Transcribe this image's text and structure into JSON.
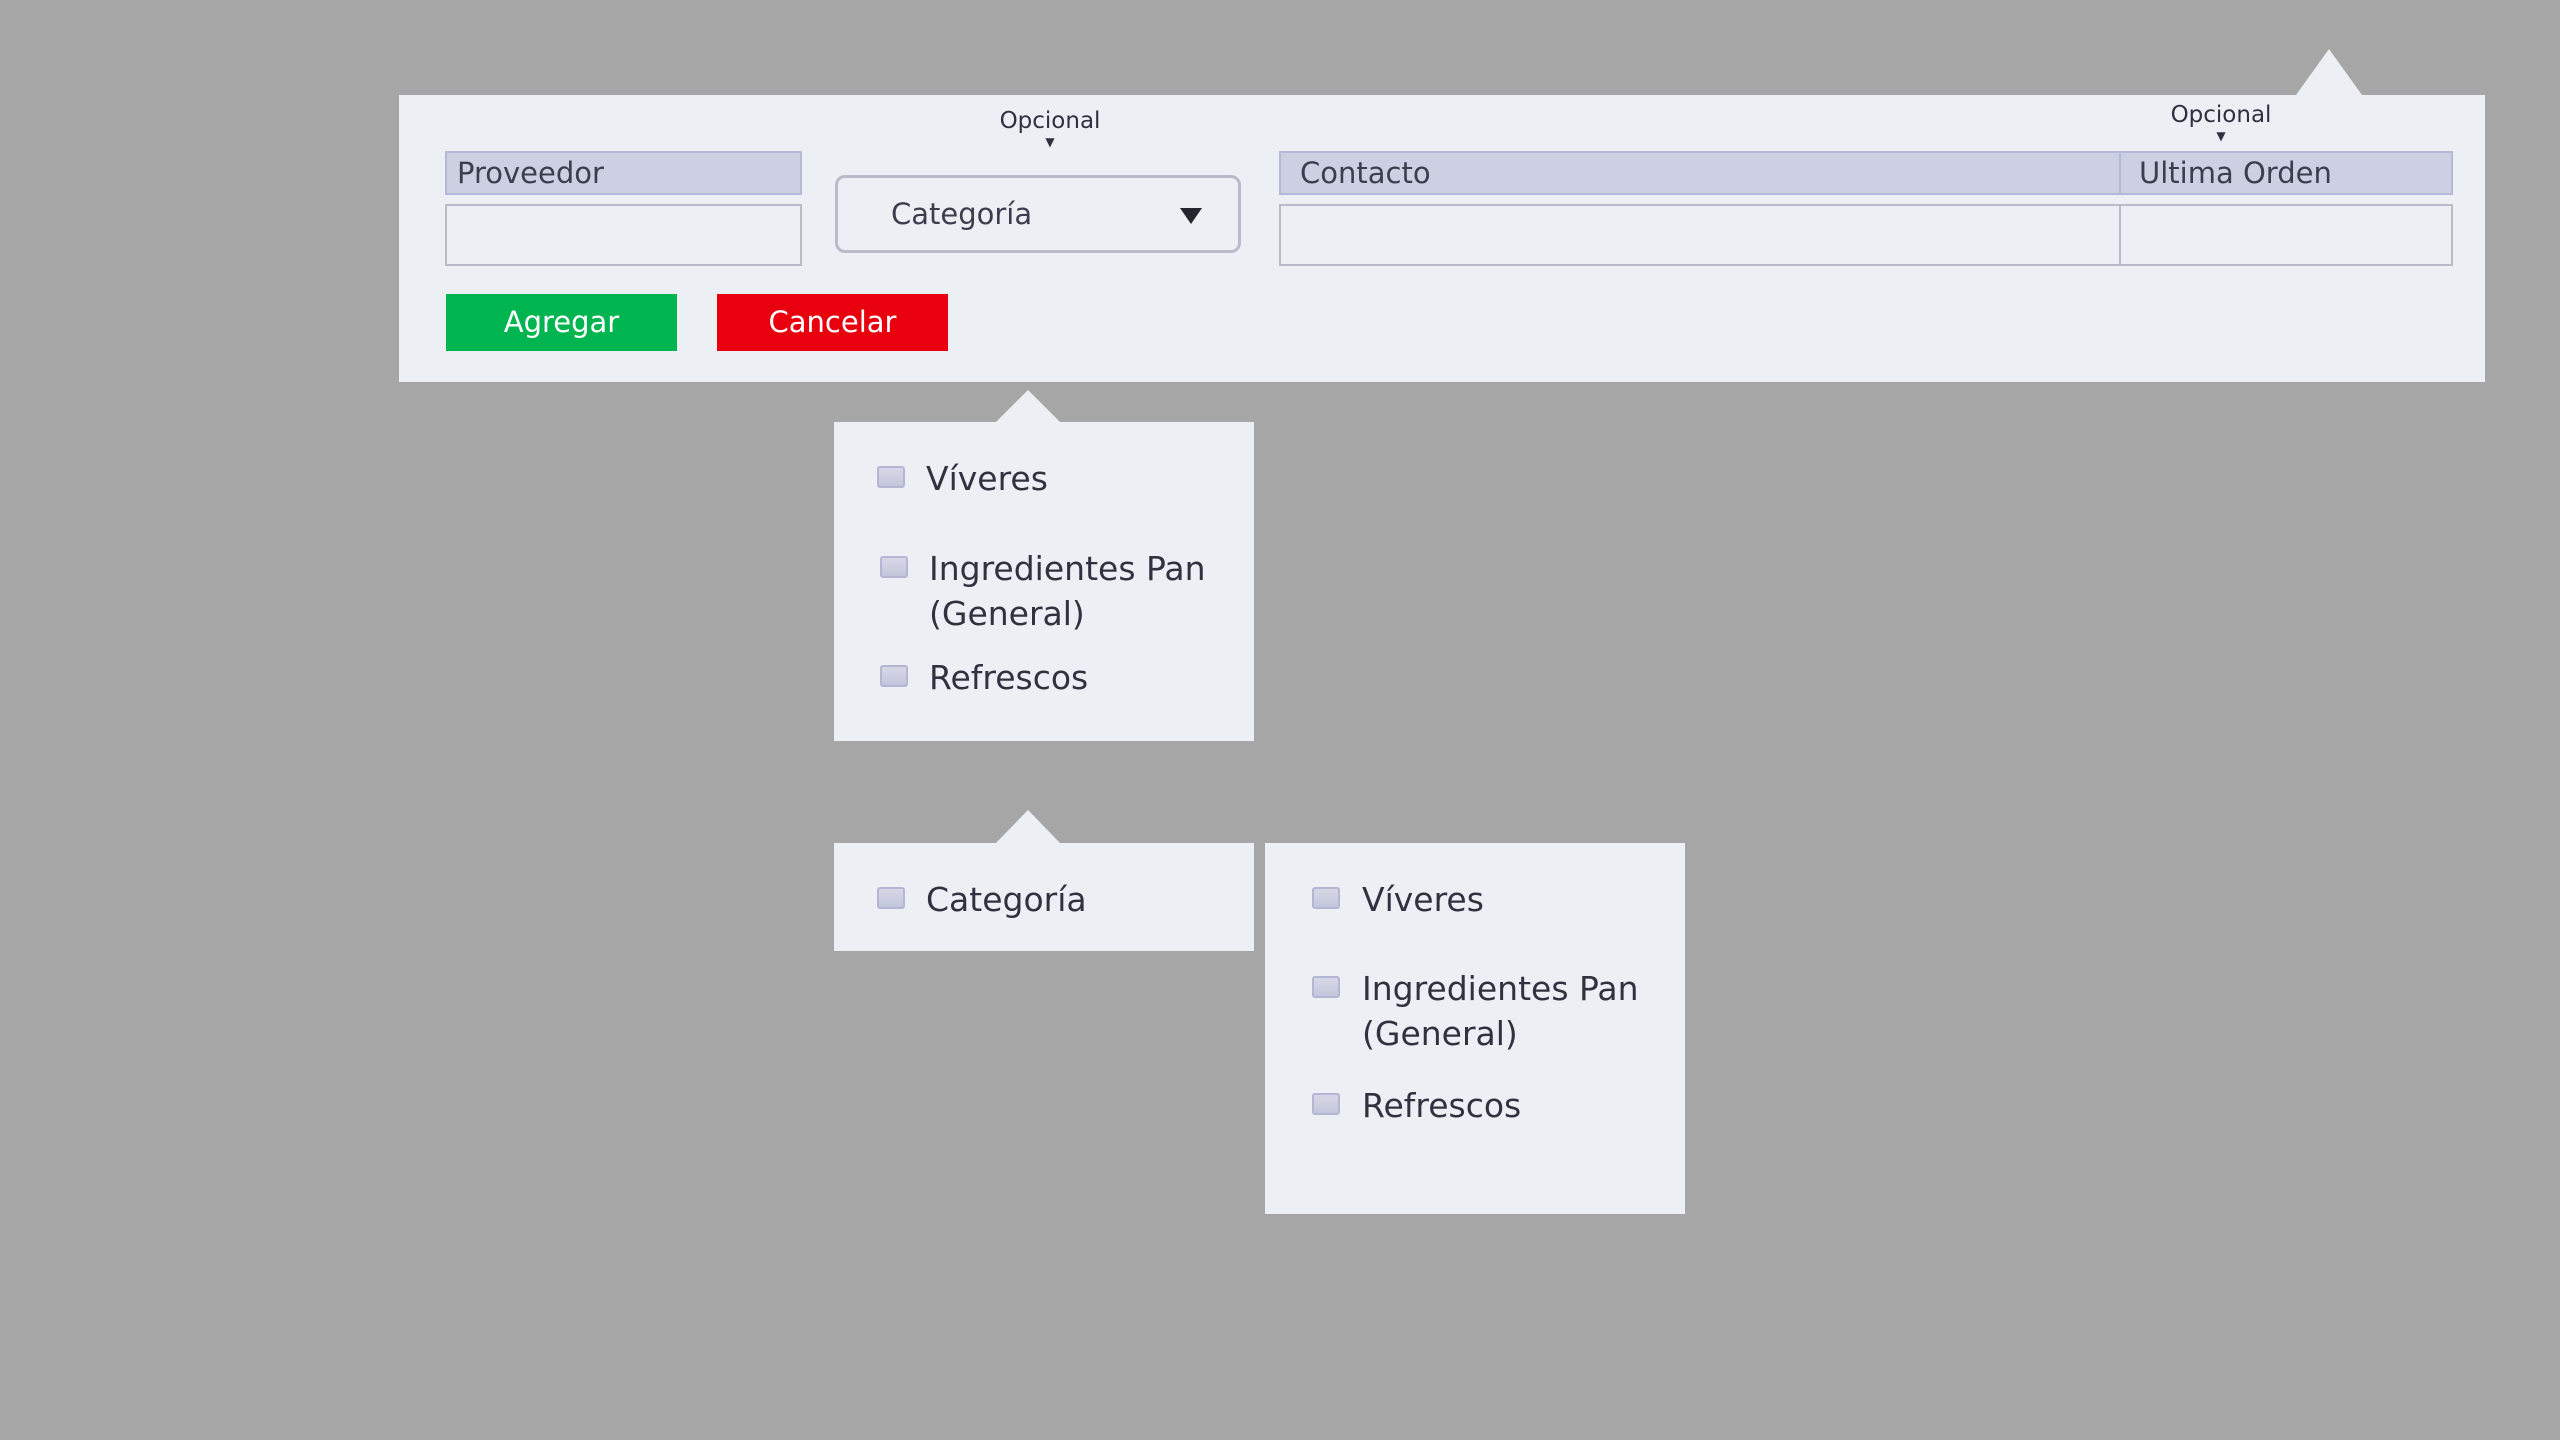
{
  "form": {
    "proveedor_label": "Proveedor",
    "categoria_hint": "Opcional",
    "categoria_select": "Categoría",
    "contacto_label": "Contacto",
    "ultima_orden_hint": "Opcional",
    "ultima_orden_label": "Ultima Orden",
    "agregar_label": "Agregar",
    "cancelar_label": "Cancelar",
    "agregar_color": "#00b550",
    "cancelar_color": "#e8000f"
  },
  "dropdown1": {
    "items": [
      "Víveres",
      "Ingredientes Pan (General)",
      "Refrescos"
    ]
  },
  "dropdown2": {
    "parent_label": "Categoría",
    "items": [
      "Víveres",
      "Ingredientes Pan (General)",
      "Refrescos"
    ]
  }
}
